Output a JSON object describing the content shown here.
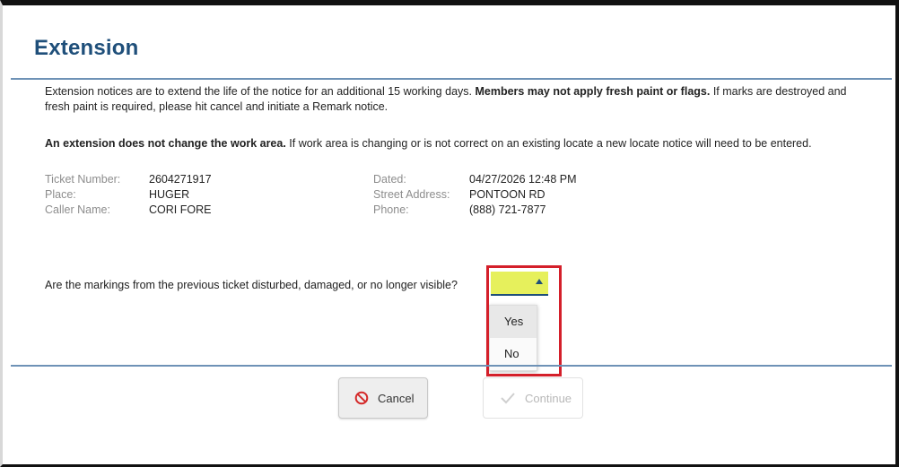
{
  "dialog": {
    "title": "Extension"
  },
  "info": {
    "p1_text": "Extension notices are to extend the life of the notice for an additional 15 working days. ",
    "p1_bold": "Members may not apply fresh paint or flags.",
    "p1_text2": " If marks are destroyed and fresh paint is required, please hit cancel and initiate a Remark notice.",
    "p2_bold": "An extension does not change the work area.",
    "p2_text": " If work area is changing or is not correct on an existing locate a new locate notice will need to be entered."
  },
  "ticket": {
    "ticket_number_label": "Ticket Number:",
    "ticket_number": "2604271917",
    "place_label": "Place:",
    "place": "HUGER",
    "caller_name_label": "Caller Name:",
    "caller_name": "CORI FORE",
    "dated_label": "Dated:",
    "dated": "04/27/2026 12:48 PM",
    "street_address_label": "Street Address:",
    "street_address": "PONTOON RD",
    "phone_label": "Phone:",
    "phone": "(888) 721-7877"
  },
  "question": {
    "text": "Are the markings from the previous ticket disturbed, damaged, or no longer visible?",
    "selected": "",
    "options": [
      "Yes",
      "No"
    ]
  },
  "buttons": {
    "cancel": "Cancel",
    "continue": "Continue"
  },
  "colors": {
    "title": "#1f4f7a",
    "select_bg": "#e6f05c",
    "highlight": "#d41f2a"
  },
  "icons": {
    "cancel": "no-entry-icon",
    "continue": "check-icon",
    "select": "caret-up-icon"
  }
}
